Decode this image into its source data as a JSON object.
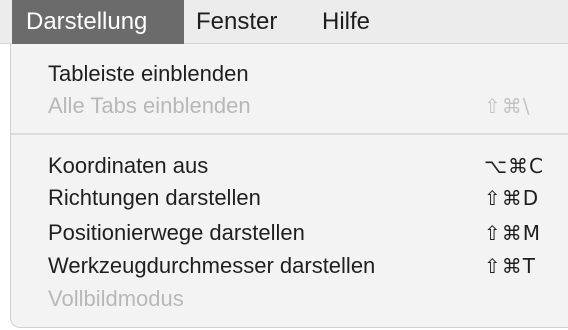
{
  "menubar": {
    "items": [
      {
        "label": "Darstellung"
      },
      {
        "label": "Fenster"
      },
      {
        "label": "Hilfe"
      }
    ]
  },
  "menu": {
    "items": [
      {
        "label": "Tableiste einblenden",
        "shortcut": "",
        "enabled": true
      },
      {
        "label": "Alle Tabs einblenden",
        "shortcut": "⇧⌘\\",
        "enabled": false
      },
      {
        "label": "Koordinaten aus",
        "shortcut": "⌥⌘C",
        "enabled": true
      },
      {
        "label": "Richtungen darstellen",
        "shortcut": "⇧⌘D",
        "enabled": true
      },
      {
        "label": "Positionierwege darstellen",
        "shortcut": "⇧⌘M",
        "enabled": true
      },
      {
        "label": "Werkzeugdurchmesser darstellen",
        "shortcut": "⇧⌘T",
        "enabled": true
      },
      {
        "label": "Vollbildmodus",
        "shortcut": "",
        "enabled": false
      }
    ]
  },
  "colors": {
    "menubar_background": "#ececec",
    "active_menu_background": "#6b6b6b",
    "dropdown_background": "#f3f3f3",
    "text": "#1f1f1f",
    "disabled_text": "#b8b8b8"
  }
}
